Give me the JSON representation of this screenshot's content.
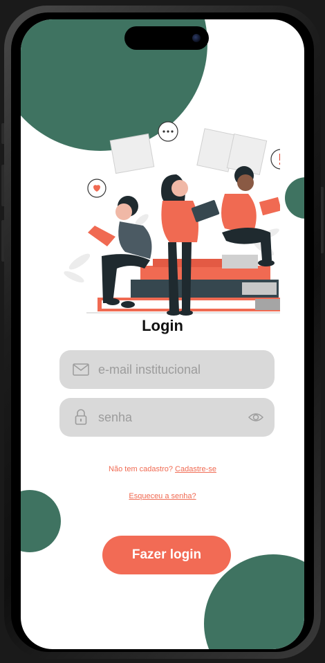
{
  "login": {
    "title": "Login",
    "email": {
      "placeholder": "e-mail institucional",
      "value": "",
      "icon": "mail-icon"
    },
    "password": {
      "placeholder": "senha",
      "value": "",
      "icon": "lock-icon",
      "toggle_icon": "eye-icon"
    },
    "signup": {
      "prompt": "Não tem cadastro?",
      "link": "Cadastre-se"
    },
    "forgot": {
      "link": "Esqueceu a senha?"
    },
    "submit_label": "Fazer login"
  },
  "colors": {
    "accent": "#f26b55",
    "blob": "#3f7361",
    "field_bg": "#d9d9d9",
    "ink": "#1f2a2f"
  }
}
